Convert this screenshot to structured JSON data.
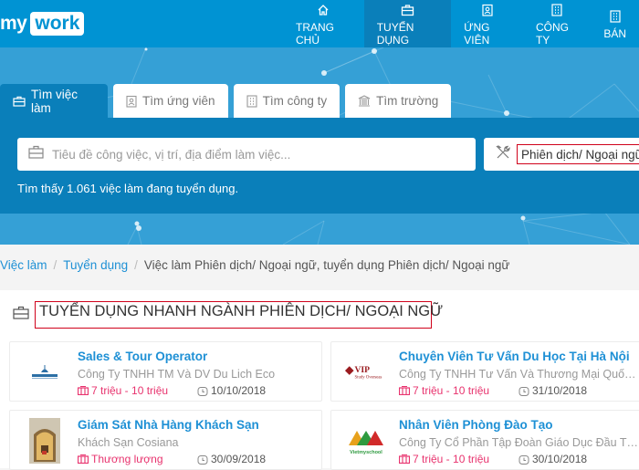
{
  "header": {
    "logo_my": "my",
    "logo_work": "work",
    "nav": [
      {
        "label": "TRANG CHỦ",
        "icon": "home-icon",
        "active": false
      },
      {
        "label": "TUYỂN DỤNG",
        "icon": "briefcase-icon",
        "active": true
      },
      {
        "label": "ỨNG VIÊN",
        "icon": "id-badge-icon",
        "active": false
      },
      {
        "label": "CÔNG TY",
        "icon": "building-icon",
        "active": false
      },
      {
        "label": "BÁN",
        "icon": "building-icon",
        "active": false
      }
    ]
  },
  "search": {
    "tabs": [
      {
        "label": "Tìm việc làm",
        "icon": "briefcase-icon",
        "active": true
      },
      {
        "label": "Tìm ứng viên",
        "icon": "id-badge-icon",
        "active": false
      },
      {
        "label": "Tìm công ty",
        "icon": "building-icon",
        "active": false
      },
      {
        "label": "Tìm trường",
        "icon": "school-icon",
        "active": false
      }
    ],
    "keyword_placeholder": "Tiêu đề công việc, vị trí, địa điểm làm việc...",
    "keyword_value": "",
    "category_value": "Phiên dịch/ Ngoại ngữ",
    "found_text": "Tìm thấy 1.061 việc làm đang tuyển dụng."
  },
  "breadcrumb": {
    "items": [
      "Việc làm",
      "Tuyển dụng"
    ],
    "current": "Việc làm Phiên dịch/ Ngoại ngữ, tuyển dụng Phiên dịch/ Ngoại ngữ",
    "separator": "/"
  },
  "section": {
    "title": "TUYỂN DỤNG NHANH NGÀNH PHIÊN DỊCH/ NGOẠI NGỮ"
  },
  "jobs": [
    {
      "title": "Sales & Tour Operator",
      "company": "Công Ty TNHH TM Và DV Du Lich Eco",
      "salary": "7 triệu - 10 triệu",
      "deadline": "10/10/2018",
      "logo": "eco-logo"
    },
    {
      "title": "Chuyên Viên Tư Vấn Du Học Tại Hà Nội",
      "company": "Công Ty TNHH Tư Vấn Và Thương Mại Quốc Tế...",
      "salary": "7 triệu - 10 triệu",
      "deadline": "31/10/2018",
      "logo": "vip-study-overseas-logo",
      "logo_text": "VIP",
      "logo_sub": "Study Overseas"
    },
    {
      "title": "Giám Sát Nhà Hàng Khách Sạn",
      "company": "Khách Sạn Cosiana",
      "salary": "Thương lượng",
      "deadline": "30/09/2018",
      "logo": "hotel-photo"
    },
    {
      "title": "Nhân Viên Phòng Đào Tạo",
      "company": "Công Ty Cổ Phần Tập Đoàn Giáo Dục Đầu Tư V...",
      "salary": "7 triệu - 10 triệu",
      "deadline": "30/10/2018",
      "logo": "vietmyschool-logo",
      "logo_text": "Vietmyschool"
    }
  ],
  "colors": {
    "brand": "#0093d3",
    "active_nav": "#0a7fba",
    "link": "#1e90d5",
    "salary": "#e8336e",
    "highlight_border": "#d0021b"
  }
}
